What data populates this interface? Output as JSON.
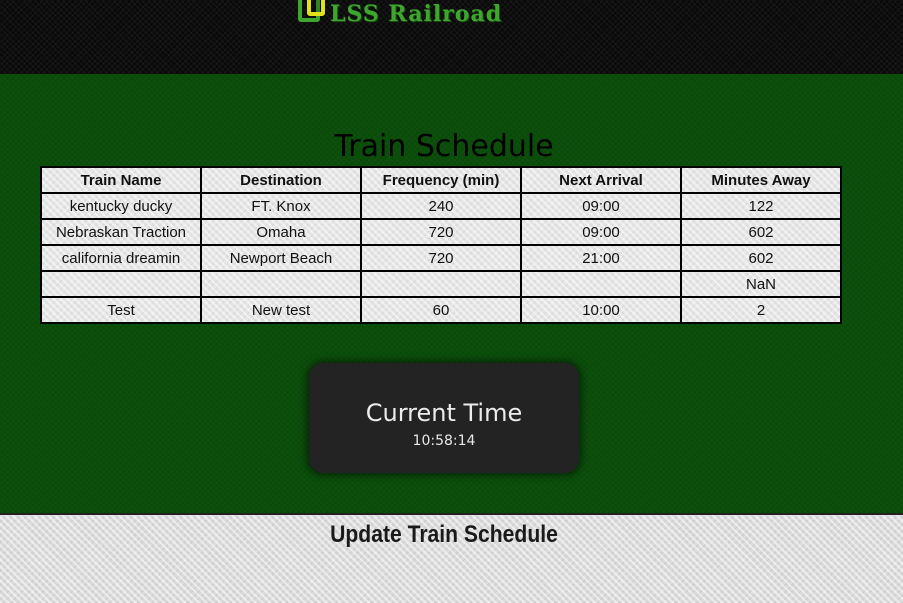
{
  "header": {
    "brand_name": "LSS Railroad",
    "brand_color": "#3ea62e",
    "logo_accent_color": "#e2e21a",
    "logo_icon": "railroad-logo-icon"
  },
  "schedule": {
    "title": "Train Schedule",
    "columns": [
      "Train Name",
      "Destination",
      "Frequency (min)",
      "Next Arrival",
      "Minutes Away"
    ],
    "rows": [
      [
        "kentucky ducky",
        "FT. Knox",
        "240",
        "09:00",
        "122"
      ],
      [
        "Nebraskan Traction",
        "Omaha",
        "720",
        "09:00",
        "602"
      ],
      [
        "california dreamin",
        "Newport Beach",
        "720",
        "21:00",
        "602"
      ],
      [
        "",
        "",
        "",
        "",
        "NaN"
      ],
      [
        "Test",
        "New test",
        "60",
        "10:00",
        "2"
      ]
    ]
  },
  "clock": {
    "label": "Current Time",
    "value": "10:58:14"
  },
  "update": {
    "title": "Update Train Schedule"
  },
  "colors": {
    "page_background": "#0c500c",
    "header_background": "#0a0a0a",
    "clock_background": "#232323"
  }
}
